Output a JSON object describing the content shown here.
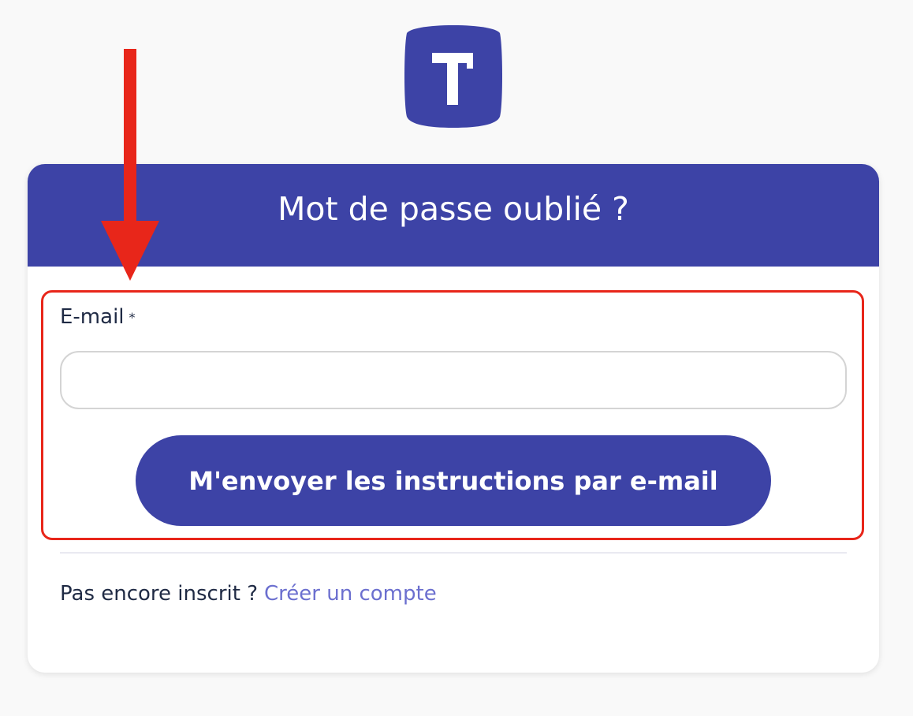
{
  "logo": {
    "icon": "t-logo-icon",
    "color": "#3d43a6"
  },
  "card": {
    "title": "Mot de passe oublié ?",
    "header_color": "#3d43a6"
  },
  "form": {
    "email_label": "E-mail",
    "required_marker": "*",
    "email_value": "",
    "submit_label": "M'envoyer les instructions par e-mail"
  },
  "footer": {
    "prompt": "Pas encore inscrit ?",
    "link_label": "Créer un compte",
    "link_color": "#6b6fcf"
  },
  "annotation": {
    "color": "#e8261a"
  }
}
